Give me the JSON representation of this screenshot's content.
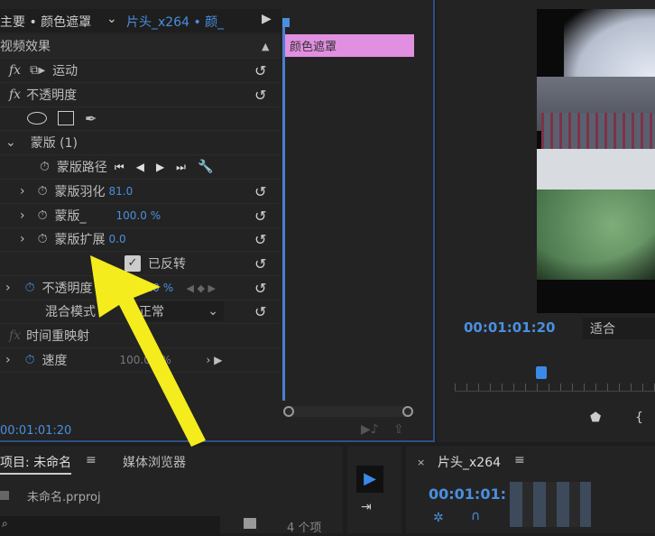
{
  "effect_controls": {
    "source_tab": "主要 • 颜色遮罩",
    "sequence_tab": "片头_x264 • 颜_",
    "section": "视频效果",
    "motion": "运动",
    "opacity": "不透明度",
    "mask": "蒙版 (1)",
    "mask_path": "蒙版路径",
    "mask_feather": "蒙版羽化",
    "mask_feather_value": "81.0",
    "mask_opacity": "蒙版_",
    "mask_opacity_value": "100.0 %",
    "mask_expansion": "蒙版扩展",
    "mask_expansion_value": "0.0",
    "inverted": "已反转",
    "opacity_prop": "不透明度",
    "opacity_value": "100.0 %",
    "blend_mode": "混合模式",
    "blend_value": "正常",
    "time_remap": "时间重映射",
    "speed": "速度",
    "speed_value": "100.00 %",
    "timecode": "00:01:01:20",
    "clip_label": "颜色遮罩"
  },
  "program": {
    "timecode": "00:01:01:20",
    "fit": "适合"
  },
  "project": {
    "tab": "项目: 未命名",
    "media_browser": "媒体浏览器",
    "file": "未命名.prproj",
    "count": "4 个项"
  },
  "timeline": {
    "tab": "片头_x264",
    "timecode": "00:01:01:"
  }
}
